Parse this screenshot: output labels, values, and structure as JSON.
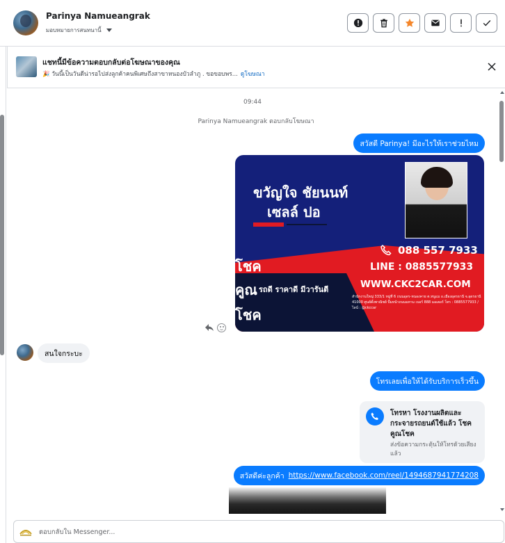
{
  "header": {
    "contact_name": "Parinya Namueangrak",
    "assign_label": "มอบหมายการสนทนานี้",
    "actions": [
      {
        "icon": "alert-circle-icon"
      },
      {
        "icon": "trash-icon"
      },
      {
        "icon": "star-icon"
      },
      {
        "icon": "envelope-icon"
      },
      {
        "icon": "exclamation-icon"
      },
      {
        "icon": "check-icon"
      }
    ]
  },
  "ad_banner": {
    "title": "แชทนี้มีข้อความตอบกลับต่อโฆษณาของคุณ",
    "subtitle": "🎉 วันนี้เป็นวันดีน่ารอไปส่งลูกค้าคนพิเศษถึงสาขาหนองบัวลำภู . ขอขอบพร...",
    "link": "ดูโฆษณา"
  },
  "chat": {
    "timestamp": "09:44",
    "system_message": "Parinya Namueangrak ตอบกลับโฆษณา",
    "msg_greeting": "สวัสดี Parinya! มีอะไรให้เราช่วยไหม",
    "card": {
      "name": "ขวัญใจ ชัยนนท์",
      "role": "เซลล์ ปอ",
      "phone": "088 557 7933",
      "line": "LINE : 0885577933",
      "website": "WWW.CKC2CAR.COM",
      "slogan": "รถดี ราคาดี มีวารันตี",
      "side_text_1": "โชค",
      "side_text_2": "คูณ",
      "side_text_3": "โชค",
      "address": "สำนักงานใหญ่ 333/1 หมู่ที่ 6 ถนนอุดร-หนองคาย ต.หนูแม อ.เมืองอุดรธานี จ.อุดรธานี 41000 ศูนย์ตั้งพาณิชย์ ปั้มหน้าถนนมหาม เบอร์ 888 มอเตอร์ โทร : 0885577933 / ไลน์ : @ckccar"
    },
    "msg_customer": "สนใจกระบะ",
    "msg_call_prompt": "โทรเลยเพื่อให้ได้รับบริการเร็วขึ้น",
    "call_card": {
      "title": "โทรหา โรงงานผลิตและกระจายรถยนต์ใช้แล้ว โชคคูณโชค",
      "subtitle": "ส่งข้อความกระตุ้นให้โทรด้วยเสียงแล้ว"
    },
    "msg_link_prefix": "สวัสดีค่ะลูกค้า",
    "msg_link_url": "https://www.facebook.com/reel/1494687941774208"
  },
  "composer": {
    "placeholder": "ตอบกลับใน Messenger..."
  },
  "colors": {
    "accent": "#0a7cff",
    "star": "#f5862a",
    "card_blue": "#14207a",
    "card_red": "#e11b22"
  }
}
